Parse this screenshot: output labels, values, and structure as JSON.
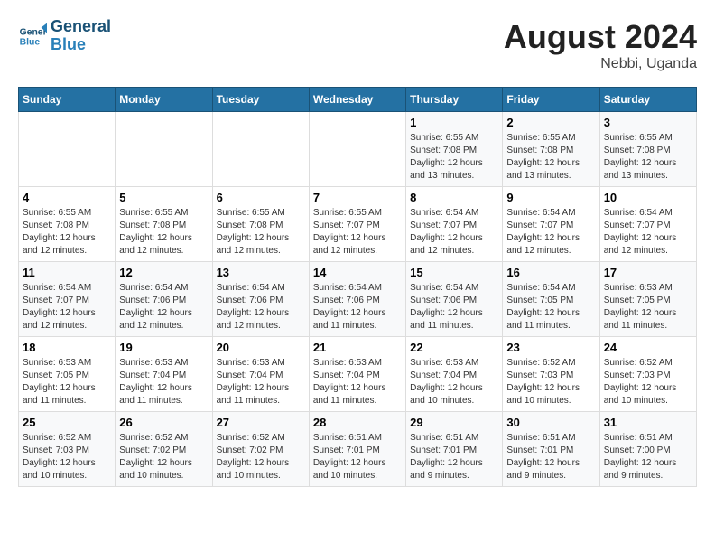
{
  "header": {
    "logo_line1": "General",
    "logo_line2": "Blue",
    "month_title": "August 2024",
    "location": "Nebbi, Uganda"
  },
  "days_of_week": [
    "Sunday",
    "Monday",
    "Tuesday",
    "Wednesday",
    "Thursday",
    "Friday",
    "Saturday"
  ],
  "weeks": [
    [
      {
        "day": "",
        "info": ""
      },
      {
        "day": "",
        "info": ""
      },
      {
        "day": "",
        "info": ""
      },
      {
        "day": "",
        "info": ""
      },
      {
        "day": "1",
        "info": "Sunrise: 6:55 AM\nSunset: 7:08 PM\nDaylight: 12 hours\nand 13 minutes."
      },
      {
        "day": "2",
        "info": "Sunrise: 6:55 AM\nSunset: 7:08 PM\nDaylight: 12 hours\nand 13 minutes."
      },
      {
        "day": "3",
        "info": "Sunrise: 6:55 AM\nSunset: 7:08 PM\nDaylight: 12 hours\nand 13 minutes."
      }
    ],
    [
      {
        "day": "4",
        "info": "Sunrise: 6:55 AM\nSunset: 7:08 PM\nDaylight: 12 hours\nand 12 minutes."
      },
      {
        "day": "5",
        "info": "Sunrise: 6:55 AM\nSunset: 7:08 PM\nDaylight: 12 hours\nand 12 minutes."
      },
      {
        "day": "6",
        "info": "Sunrise: 6:55 AM\nSunset: 7:08 PM\nDaylight: 12 hours\nand 12 minutes."
      },
      {
        "day": "7",
        "info": "Sunrise: 6:55 AM\nSunset: 7:07 PM\nDaylight: 12 hours\nand 12 minutes."
      },
      {
        "day": "8",
        "info": "Sunrise: 6:54 AM\nSunset: 7:07 PM\nDaylight: 12 hours\nand 12 minutes."
      },
      {
        "day": "9",
        "info": "Sunrise: 6:54 AM\nSunset: 7:07 PM\nDaylight: 12 hours\nand 12 minutes."
      },
      {
        "day": "10",
        "info": "Sunrise: 6:54 AM\nSunset: 7:07 PM\nDaylight: 12 hours\nand 12 minutes."
      }
    ],
    [
      {
        "day": "11",
        "info": "Sunrise: 6:54 AM\nSunset: 7:07 PM\nDaylight: 12 hours\nand 12 minutes."
      },
      {
        "day": "12",
        "info": "Sunrise: 6:54 AM\nSunset: 7:06 PM\nDaylight: 12 hours\nand 12 minutes."
      },
      {
        "day": "13",
        "info": "Sunrise: 6:54 AM\nSunset: 7:06 PM\nDaylight: 12 hours\nand 12 minutes."
      },
      {
        "day": "14",
        "info": "Sunrise: 6:54 AM\nSunset: 7:06 PM\nDaylight: 12 hours\nand 11 minutes."
      },
      {
        "day": "15",
        "info": "Sunrise: 6:54 AM\nSunset: 7:06 PM\nDaylight: 12 hours\nand 11 minutes."
      },
      {
        "day": "16",
        "info": "Sunrise: 6:54 AM\nSunset: 7:05 PM\nDaylight: 12 hours\nand 11 minutes."
      },
      {
        "day": "17",
        "info": "Sunrise: 6:53 AM\nSunset: 7:05 PM\nDaylight: 12 hours\nand 11 minutes."
      }
    ],
    [
      {
        "day": "18",
        "info": "Sunrise: 6:53 AM\nSunset: 7:05 PM\nDaylight: 12 hours\nand 11 minutes."
      },
      {
        "day": "19",
        "info": "Sunrise: 6:53 AM\nSunset: 7:04 PM\nDaylight: 12 hours\nand 11 minutes."
      },
      {
        "day": "20",
        "info": "Sunrise: 6:53 AM\nSunset: 7:04 PM\nDaylight: 12 hours\nand 11 minutes."
      },
      {
        "day": "21",
        "info": "Sunrise: 6:53 AM\nSunset: 7:04 PM\nDaylight: 12 hours\nand 11 minutes."
      },
      {
        "day": "22",
        "info": "Sunrise: 6:53 AM\nSunset: 7:04 PM\nDaylight: 12 hours\nand 10 minutes."
      },
      {
        "day": "23",
        "info": "Sunrise: 6:52 AM\nSunset: 7:03 PM\nDaylight: 12 hours\nand 10 minutes."
      },
      {
        "day": "24",
        "info": "Sunrise: 6:52 AM\nSunset: 7:03 PM\nDaylight: 12 hours\nand 10 minutes."
      }
    ],
    [
      {
        "day": "25",
        "info": "Sunrise: 6:52 AM\nSunset: 7:03 PM\nDaylight: 12 hours\nand 10 minutes."
      },
      {
        "day": "26",
        "info": "Sunrise: 6:52 AM\nSunset: 7:02 PM\nDaylight: 12 hours\nand 10 minutes."
      },
      {
        "day": "27",
        "info": "Sunrise: 6:52 AM\nSunset: 7:02 PM\nDaylight: 12 hours\nand 10 minutes."
      },
      {
        "day": "28",
        "info": "Sunrise: 6:51 AM\nSunset: 7:01 PM\nDaylight: 12 hours\nand 10 minutes."
      },
      {
        "day": "29",
        "info": "Sunrise: 6:51 AM\nSunset: 7:01 PM\nDaylight: 12 hours\nand 9 minutes."
      },
      {
        "day": "30",
        "info": "Sunrise: 6:51 AM\nSunset: 7:01 PM\nDaylight: 12 hours\nand 9 minutes."
      },
      {
        "day": "31",
        "info": "Sunrise: 6:51 AM\nSunset: 7:00 PM\nDaylight: 12 hours\nand 9 minutes."
      }
    ]
  ]
}
